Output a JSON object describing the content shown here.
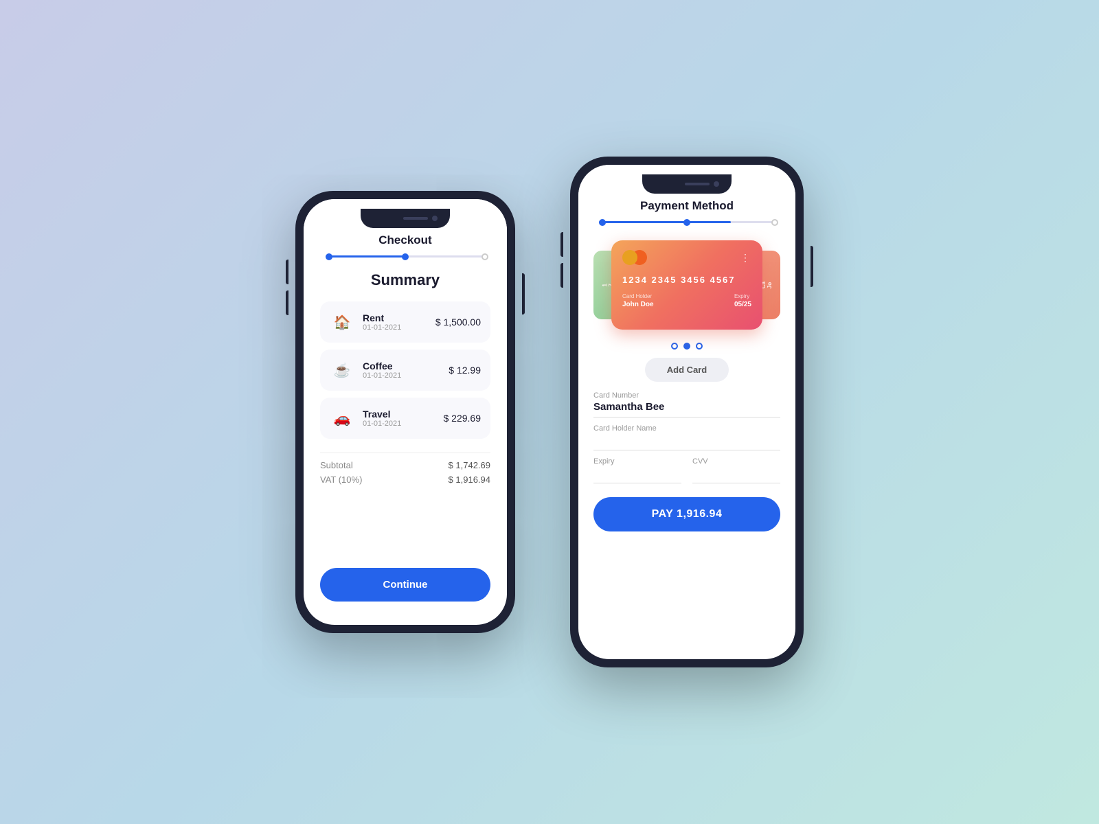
{
  "checkout": {
    "title": "Checkout",
    "summary_title": "Summary",
    "progress": {
      "step1_filled": true,
      "step2_active": true,
      "step3_empty": true,
      "fill_percent": 50
    },
    "items": [
      {
        "name": "Rent",
        "date": "01-01-2021",
        "amount": "$ 1,500.00",
        "icon": "🏠"
      },
      {
        "name": "Coffee",
        "date": "01-01-2021",
        "amount": "$ 12.99",
        "icon": "☕"
      },
      {
        "name": "Travel",
        "date": "01-01-2021",
        "amount": "$ 229.69",
        "icon": "🚗"
      }
    ],
    "subtotal_label": "Subtotal",
    "subtotal_value": "$ 1,742.69",
    "vat_label": "VAT (10%)",
    "vat_value": "$ 1,916.94",
    "continue_button": "Continue"
  },
  "payment": {
    "title": "Payment Method",
    "progress": {
      "fill_percent": 75
    },
    "card": {
      "number": "1234  2345  3456  4567",
      "holder_label": "Card Holder",
      "holder_value": "John Doe",
      "expiry_label": "Expiry",
      "expiry_value": "05/25",
      "dots_menu": "⋮"
    },
    "carousel_dots": [
      {
        "active": false
      },
      {
        "active": true
      },
      {
        "active": false
      }
    ],
    "add_card_button": "Add Card",
    "form": {
      "card_number_label": "Card Number",
      "card_number_value": "Samantha Bee",
      "holder_name_label": "Card Holder Name",
      "holder_name_value": "",
      "expiry_label": "Expiry",
      "expiry_value": "",
      "cvv_label": "CVV",
      "cvv_value": ""
    },
    "pay_button": "PAY 1,916.94"
  }
}
